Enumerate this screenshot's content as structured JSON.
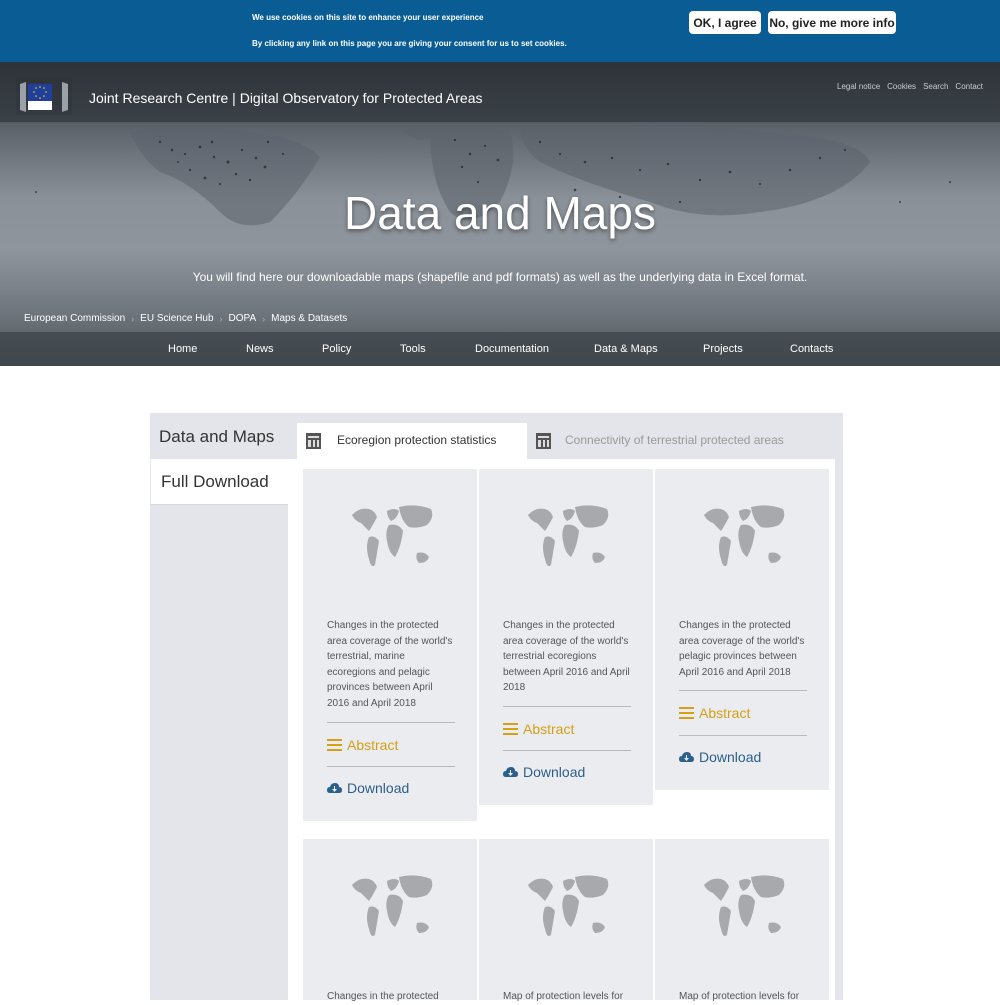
{
  "cookie": {
    "line1": "We use cookies on this site to enhance your user experience",
    "line2": "By clicking any link on this page you are giving your consent for us to set cookies.",
    "ok_label": "OK, I agree",
    "more_label": "No, give me more info"
  },
  "header": {
    "logo_text": "European Commission",
    "site_title": "Joint Research Centre | Digital Observatory for Protected Areas",
    "tool_links": [
      "Legal notice",
      "Cookies",
      "Search",
      "Contact"
    ]
  },
  "hero": {
    "title": "Data and Maps",
    "subtitle": "You will find here our downloadable maps (shapefile and pdf formats) as well as the underlying data in Excel format."
  },
  "breadcrumb": [
    "European Commission",
    "EU Science Hub",
    "DOPA",
    "Maps & Datasets"
  ],
  "nav": [
    "Home",
    "News",
    "Policy",
    "Tools",
    "Documentation",
    "Data & Maps",
    "Projects",
    "Contacts"
  ],
  "sidebar": {
    "items": [
      {
        "label": "Data and Maps",
        "active": true
      },
      {
        "label": "Full Download",
        "active": false
      }
    ]
  },
  "tabs": [
    {
      "label": "Ecoregion protection statistics",
      "active": true,
      "icon": "folder-icon"
    },
    {
      "label": "Connectivity of terrestrial protected areas",
      "active": false,
      "icon": "folder-icon"
    }
  ],
  "cards": [
    {
      "desc": "Changes in the protected area coverage of the world's terrestrial, marine ecoregions and pelagic provinces between April 2016 and April 2018",
      "abstract": "Abstract",
      "download": "Download"
    },
    {
      "desc": "Changes in the protected area coverage of the world's terrestrial ecoregions between April 2016 and April 2018",
      "abstract": "Abstract",
      "download": "Download"
    },
    {
      "desc": "Changes in the protected area coverage of the world's pelagic provinces between April 2016 and April 2018",
      "abstract": "Abstract",
      "download": "Download"
    },
    {
      "desc": "Changes in the protected"
    },
    {
      "desc": "Map of protection levels for"
    },
    {
      "desc": "Map of protection levels for"
    }
  ],
  "colors": {
    "cookie_bar": "#0a5d94",
    "abstract": "#d4a017",
    "download": "#2c5f8a",
    "card_bg": "#ebecf0"
  }
}
